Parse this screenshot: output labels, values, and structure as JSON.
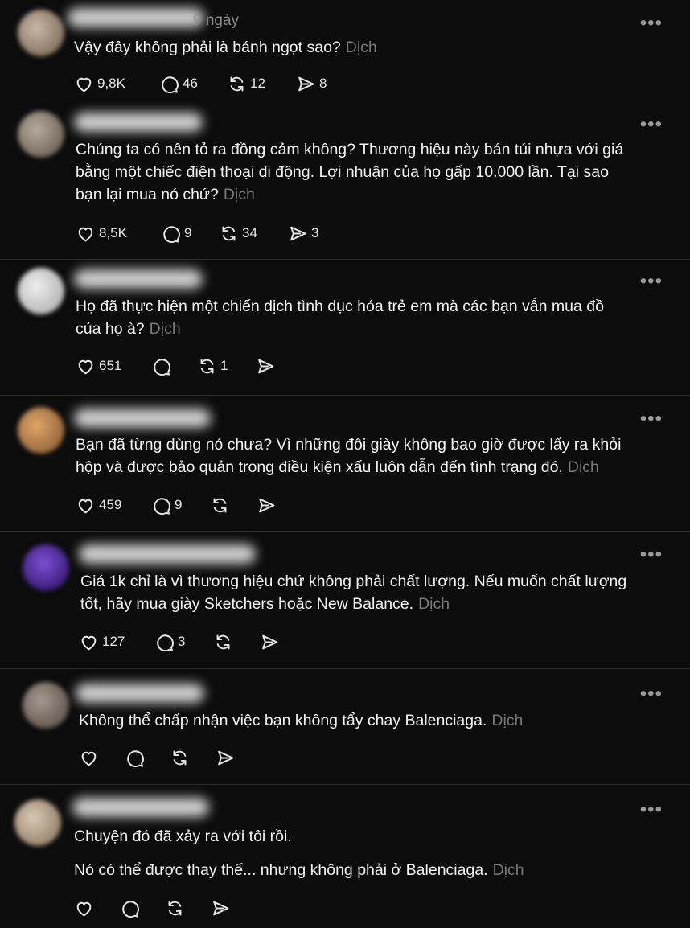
{
  "translate_label": "Dịch",
  "posts": [
    {
      "time": "9 ngày",
      "lines": [
        "Vậy đây không phải là bánh ngọt sao?"
      ],
      "counts": {
        "likes": "9,8K",
        "replies": "46",
        "reposts": "12",
        "shares": "8"
      }
    },
    {
      "lines": [
        "Chúng ta có nên tỏ ra đồng cảm không? Thương hiệu này bán túi nhựa với giá",
        "bằng một chiếc điện thoại di động. Lợi nhuận của họ gấp 10.000 lần. Tại sao",
        "bạn lại mua nó chứ?"
      ],
      "counts": {
        "likes": "8,5K",
        "replies": "9",
        "reposts": "34",
        "shares": "3"
      }
    },
    {
      "lines": [
        "Họ đã thực hiện một chiến dịch tình dục hóa trẻ em mà các bạn vẫn mua đồ",
        "của họ à?"
      ],
      "counts": {
        "likes": "651",
        "replies": "",
        "reposts": "1",
        "shares": ""
      }
    },
    {
      "lines": [
        "Bạn đã từng dùng nó chưa? Vì những đôi giày không bao giờ được lấy ra khỏi",
        "hộp và được bảo quản trong điều kiện xấu luôn dẫn đến tình trạng đó."
      ],
      "counts": {
        "likes": "459",
        "replies": "9",
        "reposts": "",
        "shares": ""
      }
    },
    {
      "lines": [
        "Giá 1k chỉ là vì thương hiệu chứ không phải chất lượng. Nếu muốn chất lượng",
        "tốt, hãy mua giày Sketchers hoặc New Balance."
      ],
      "counts": {
        "likes": "127",
        "replies": "3",
        "reposts": "",
        "shares": ""
      }
    },
    {
      "lines": [
        "Không thể chấp nhận việc bạn không tẩy chay Balenciaga."
      ],
      "counts": {
        "likes": "",
        "replies": "",
        "reposts": "",
        "shares": ""
      }
    },
    {
      "lines": [
        "Chuyện đó đã xảy ra với tôi rồi.",
        "",
        "Nó có thể được thay thế... nhưng không phải ở Balenciaga."
      ],
      "counts": {
        "likes": "",
        "replies": "",
        "reposts": "",
        "shares": ""
      }
    }
  ],
  "icons": {
    "like": "heart-icon",
    "reply": "comment-icon",
    "repost": "repost-icon",
    "share": "send-icon",
    "more": "more-icon"
  },
  "colors": {
    "background": "#0c0c0c",
    "text": "#f2f2f2",
    "muted": "#7a7a7a"
  }
}
